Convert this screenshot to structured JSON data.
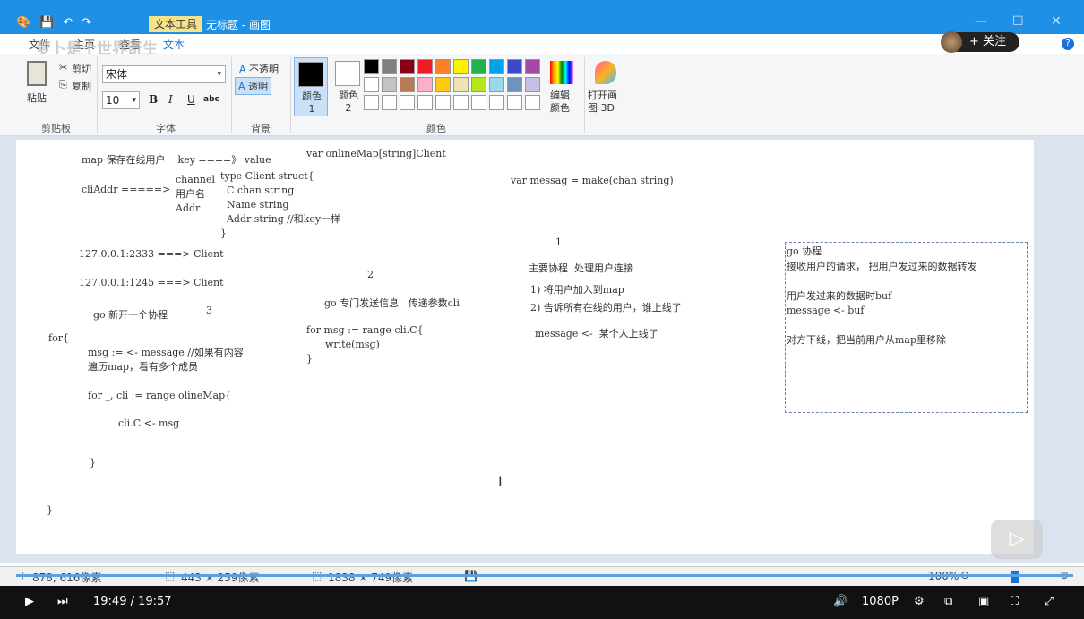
{
  "titlebar": {
    "context_tab": "文本工具",
    "window_title": "无标题 - 画图",
    "min": "—",
    "max": "☐",
    "close": "✕"
  },
  "tabs": {
    "file": "文件",
    "home": "主页",
    "view": "查看",
    "text": "文本"
  },
  "watermark": "萝卜是个世界奇生",
  "follow": "+ 关注",
  "clipboard": {
    "paste": "粘贴",
    "cut": "剪切",
    "copy": "复制",
    "group": "剪贴板"
  },
  "font": {
    "family": "宋体",
    "size": "10",
    "bold": "B",
    "italic": "I",
    "underline": "U",
    "strike": "abc",
    "group": "字体"
  },
  "background": {
    "opaque": "不透明",
    "transparent": "透明",
    "group": "背景"
  },
  "colors": {
    "color1": "颜色 1",
    "color2": "颜色 2",
    "edit": "编辑颜色",
    "paint3d": "打开画图 3D",
    "group": "颜色",
    "palette_row1": [
      "#000000",
      "#7f7f7f",
      "#880015",
      "#ed1c24",
      "#ff7f27",
      "#fff200",
      "#22b14c",
      "#00a2e8",
      "#3f48cc",
      "#a349a4"
    ],
    "palette_row2": [
      "#ffffff",
      "#c3c3c3",
      "#b97a57",
      "#ffaec9",
      "#ffc90e",
      "#efe4b0",
      "#b5e61d",
      "#99d9ea",
      "#7092be",
      "#c8bfe7"
    ]
  },
  "canvas_text": {
    "t1": "map 保存在线用户    key ====》 value",
    "t2": "var onlineMap[string]Client",
    "t3": "cliAddr =====>",
    "t4": "channel\n用户名\nAddr",
    "t5": "type Client struct{\n  C chan string\n  Name string\n  Addr string //和key一样\n}",
    "t6": "var messag = make(chan string)",
    "t7": "1",
    "t8": "127.0.0.1:2333 ===> Client",
    "t9": "2",
    "t10": "主要协程  处理用户连接",
    "t11": "127.0.0.1:1245 ===> Client",
    "t12": "1) 将用户加入到map",
    "t13": "go 专门发送信息   传递参数cli",
    "t14": "2) 告诉所有在线的用户，谁上线了",
    "t15": "go 新开一个协程",
    "t16": "3",
    "t17": "for msg := range cli.C{\n      write(msg)\n}",
    "t18": "message <-  某个人上线了",
    "t19": "for{",
    "t20": "msg := <- message //如果有内容\n遍历map，看有多个成员",
    "t21": "for _, cli := range olineMap{",
    "t22": "cli.C <- msg",
    "t23": "}",
    "t24": "}",
    "sel": "go 协程\n接收用户的请求， 把用户发过来的数据转发\n\n用户发过来的数据时buf\nmessage <- buf\n\n对方下线，把当前用户从map里移除"
  },
  "status": {
    "pos": "878, 616像素",
    "sel": "443 × 259像素",
    "size": "1838 × 749像素",
    "zoom": "100%"
  },
  "player": {
    "time": "19:49 / 19:57",
    "quality": "1080P"
  }
}
